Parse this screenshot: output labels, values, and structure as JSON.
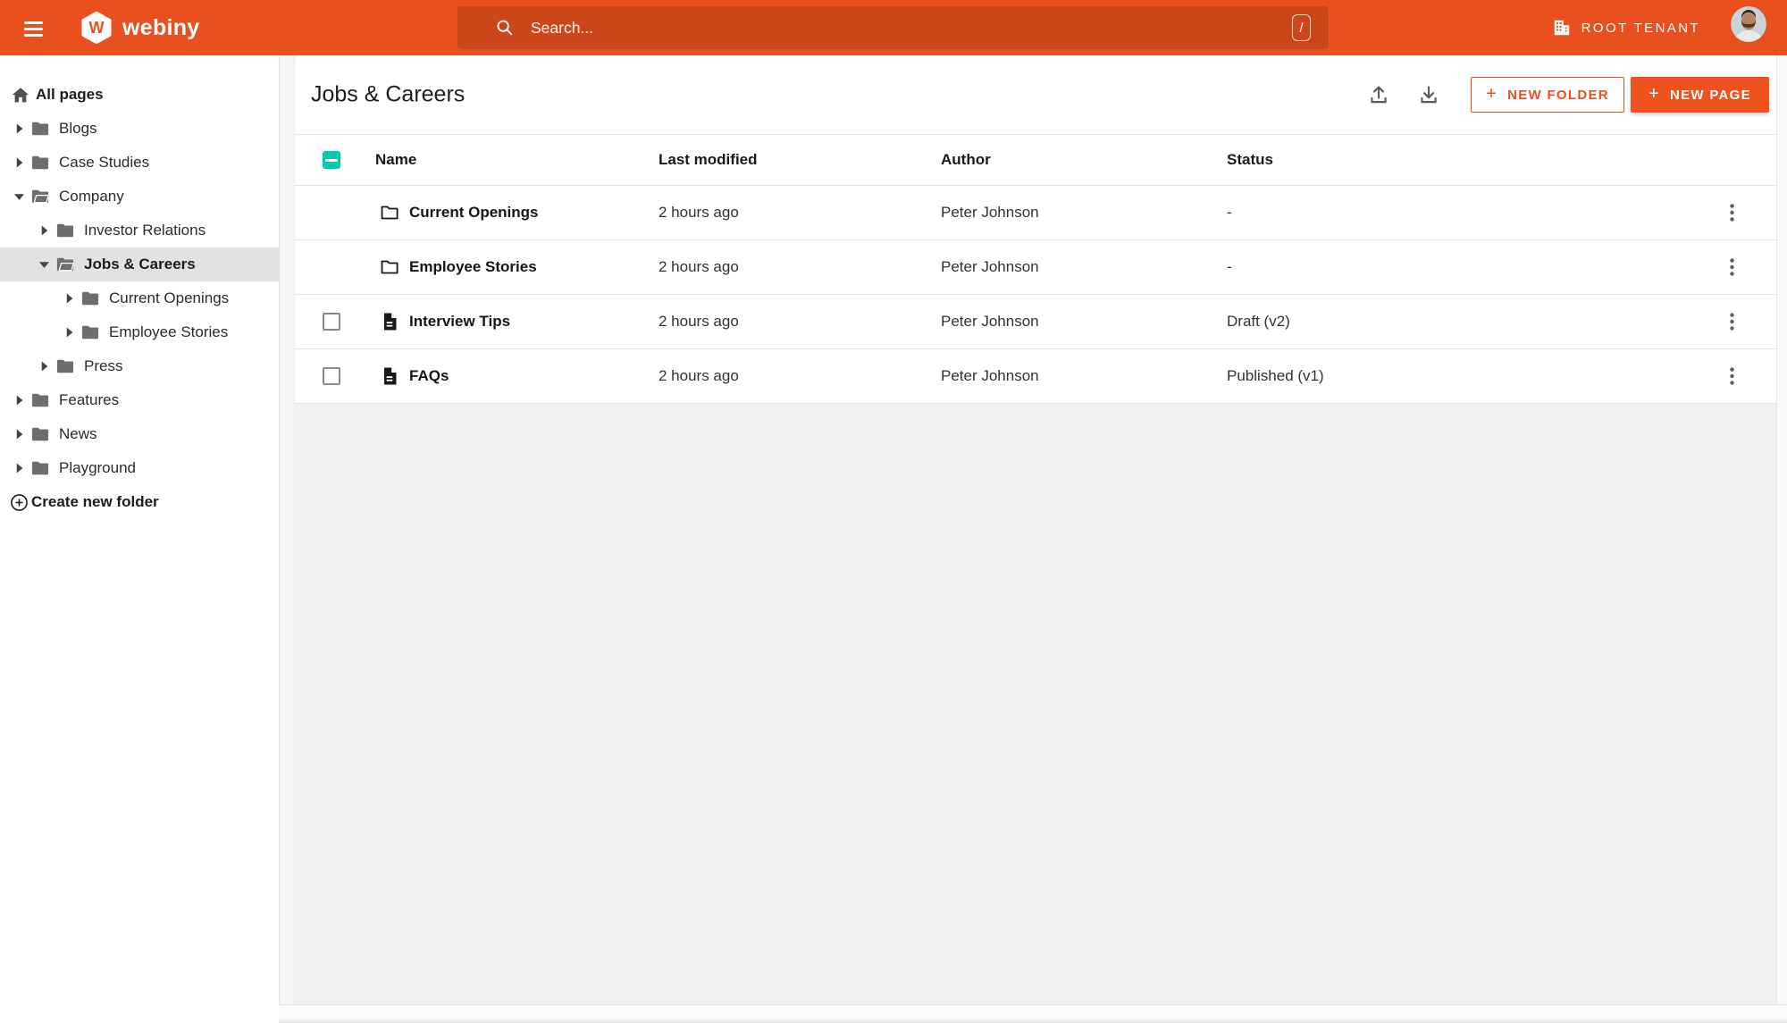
{
  "topbar": {
    "brand": "webiny",
    "search": {
      "placeholder": "Search...",
      "shortcut_key": "/"
    },
    "tenant": "ROOT TENANT"
  },
  "sidebar": {
    "root": "All pages",
    "items": [
      {
        "label": "Blogs"
      },
      {
        "label": "Case Studies"
      },
      {
        "label": "Company"
      },
      {
        "label": "Investor Relations"
      },
      {
        "label": "Jobs & Careers"
      },
      {
        "label": "Current Openings"
      },
      {
        "label": "Employee Stories"
      },
      {
        "label": "Press"
      },
      {
        "label": "Features"
      },
      {
        "label": "News"
      },
      {
        "label": "Playground"
      }
    ],
    "create_folder": "Create new folder"
  },
  "main": {
    "title": "Jobs & Careers",
    "actions": {
      "plus": "+",
      "new_folder": "NEW FOLDER",
      "new_page": "NEW PAGE"
    },
    "table": {
      "headers": {
        "name": "Name",
        "modified": "Last modified",
        "author": "Author",
        "status": "Status"
      },
      "rows": [
        {
          "type": "folder",
          "name": "Current Openings",
          "modified": "2 hours ago",
          "author": "Peter Johnson",
          "status": "-"
        },
        {
          "type": "folder",
          "name": "Employee Stories",
          "modified": "2 hours ago",
          "author": "Peter Johnson",
          "status": "-"
        },
        {
          "type": "page",
          "name": "Interview Tips",
          "modified": "2 hours ago",
          "author": "Peter Johnson",
          "status": "Draft (v2)"
        },
        {
          "type": "page",
          "name": "FAQs",
          "modified": "2 hours ago",
          "author": "Peter Johnson",
          "status": "Published (v1)"
        }
      ]
    }
  },
  "colors": {
    "primary": "#e8501f",
    "accent_teal": "#00ccb0"
  }
}
